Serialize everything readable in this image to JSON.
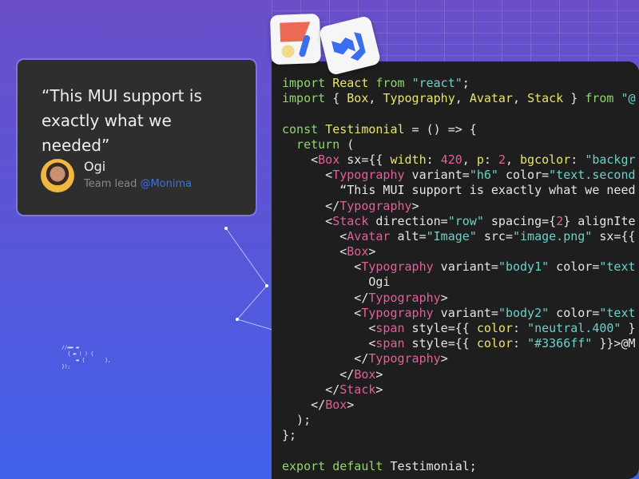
{
  "testimonial": {
    "quote": "“This MUI support is exactly what we needed”",
    "name": "Ogi",
    "role": "Team lead",
    "company": "@Monima",
    "link_color": "#3366ff"
  },
  "icons": [
    "joy-ui-logo",
    "mui-logo"
  ],
  "code_lines": [
    [
      [
        "kw",
        "import "
      ],
      [
        "id",
        "React "
      ],
      [
        "kw",
        "from "
      ],
      [
        "str",
        "\"react\""
      ],
      [
        "",
        "; "
      ]
    ],
    [
      [
        "kw",
        "import "
      ],
      [
        "",
        "{ "
      ],
      [
        "id",
        "Box"
      ],
      [
        "",
        ", "
      ],
      [
        "id",
        "Typography"
      ],
      [
        "",
        ", "
      ],
      [
        "id",
        "Avatar"
      ],
      [
        "",
        ", "
      ],
      [
        "id",
        "Stack"
      ],
      [
        "",
        " } "
      ],
      [
        "kw",
        "from "
      ],
      [
        "str",
        "\"@"
      ]
    ],
    [],
    [
      [
        "kw",
        "const "
      ],
      [
        "id",
        "Testimonial"
      ],
      [
        "",
        " = () => {"
      ]
    ],
    [
      [
        "kw",
        "  return "
      ],
      [
        "",
        "("
      ]
    ],
    [
      [
        "",
        "    <"
      ],
      [
        "tag",
        "Box"
      ],
      [
        "",
        " sx={{ "
      ],
      [
        "id",
        "width"
      ],
      [
        "",
        ": "
      ],
      [
        "num",
        "420"
      ],
      [
        "",
        ", "
      ],
      [
        "id",
        "p"
      ],
      [
        "",
        ": "
      ],
      [
        "num",
        "2"
      ],
      [
        "",
        ", "
      ],
      [
        "id",
        "bgcolor"
      ],
      [
        "",
        ": "
      ],
      [
        "str",
        "\"backgr"
      ]
    ],
    [
      [
        "",
        "      <"
      ],
      [
        "tag",
        "Typography"
      ],
      [
        "",
        " variant="
      ],
      [
        "str",
        "\"h6\""
      ],
      [
        "",
        " color="
      ],
      [
        "str",
        "\"text.second"
      ]
    ],
    [
      [
        "",
        "        “This MUI support is exactly what we need"
      ]
    ],
    [
      [
        "",
        "      </"
      ],
      [
        "tag",
        "Typography"
      ],
      [
        "",
        ">"
      ]
    ],
    [
      [
        "",
        "      <"
      ],
      [
        "tag",
        "Stack"
      ],
      [
        "",
        " direction="
      ],
      [
        "str",
        "\"row\""
      ],
      [
        "",
        " spacing={"
      ],
      [
        "num",
        "2"
      ],
      [
        "",
        "} alignIte"
      ]
    ],
    [
      [
        "",
        "        <"
      ],
      [
        "tag",
        "Avatar"
      ],
      [
        "",
        " alt="
      ],
      [
        "str",
        "\"Image\""
      ],
      [
        "",
        " src="
      ],
      [
        "str",
        "\"image.png\""
      ],
      [
        "",
        " sx={{"
      ]
    ],
    [
      [
        "",
        "        <"
      ],
      [
        "tag",
        "Box"
      ],
      [
        "",
        ">"
      ]
    ],
    [
      [
        "",
        "          <"
      ],
      [
        "tag",
        "Typography"
      ],
      [
        "",
        " variant="
      ],
      [
        "str",
        "\"body1\""
      ],
      [
        "",
        " color="
      ],
      [
        "str",
        "\"text"
      ]
    ],
    [
      [
        "",
        "            Ogi"
      ]
    ],
    [
      [
        "",
        "          </"
      ],
      [
        "tag",
        "Typography"
      ],
      [
        "",
        ">"
      ]
    ],
    [
      [
        "",
        "          <"
      ],
      [
        "tag",
        "Typography"
      ],
      [
        "",
        " variant="
      ],
      [
        "str",
        "\"body2\""
      ],
      [
        "",
        " color="
      ],
      [
        "str",
        "\"text"
      ]
    ],
    [
      [
        "",
        "            <"
      ],
      [
        "tag",
        "span"
      ],
      [
        "",
        " style={{ "
      ],
      [
        "id",
        "color"
      ],
      [
        "",
        ": "
      ],
      [
        "str",
        "\"neutral.400\""
      ],
      [
        "",
        " }"
      ]
    ],
    [
      [
        "",
        "            <"
      ],
      [
        "tag",
        "span"
      ],
      [
        "",
        " style={{ "
      ],
      [
        "id",
        "color"
      ],
      [
        "",
        ": "
      ],
      [
        "str",
        "\"#3366ff\""
      ],
      [
        "",
        " }}>@M"
      ]
    ],
    [
      [
        "",
        "          </"
      ],
      [
        "tag",
        "Typography"
      ],
      [
        "",
        ">"
      ]
    ],
    [
      [
        "",
        "        </"
      ],
      [
        "tag",
        "Box"
      ],
      [
        "",
        ">"
      ]
    ],
    [
      [
        "",
        "      </"
      ],
      [
        "tag",
        "Stack"
      ],
      [
        "",
        ">"
      ]
    ],
    [
      [
        "",
        "    </"
      ],
      [
        "tag",
        "Box"
      ],
      [
        "",
        ">"
      ]
    ],
    [
      [
        "",
        "  );"
      ]
    ],
    [
      [
        "",
        "};"
      ]
    ],
    [],
    [
      [
        "kw",
        "export "
      ],
      [
        "kw",
        "default "
      ],
      [
        "",
        "Testimonial;"
      ]
    ]
  ]
}
